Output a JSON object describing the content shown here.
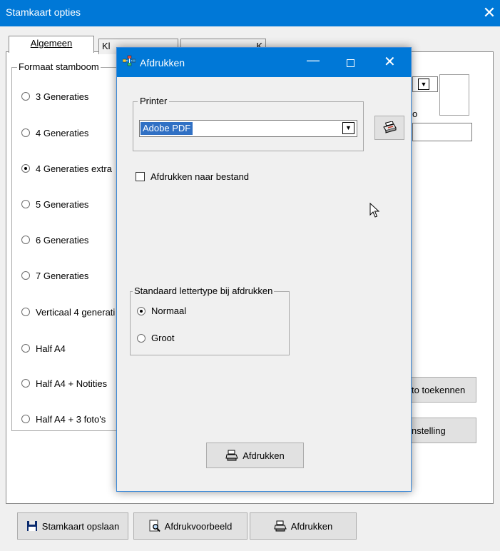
{
  "main_window": {
    "title": "Stamkaart opties",
    "close_glyph": "✕",
    "tabs": [
      "Algemeen",
      "Klein instellingen",
      "Kaart"
    ],
    "tab_visible": [
      "Algemeen",
      "Kl",
      "K"
    ],
    "format_group": {
      "label": "Formaat stamboom",
      "options": [
        {
          "label": "3 Generaties",
          "checked": false
        },
        {
          "label": "4 Generaties",
          "checked": false
        },
        {
          "label": "4 Generaties extra",
          "checked": true
        },
        {
          "label": "5 Generaties",
          "checked": false
        },
        {
          "label": "6 Generaties",
          "checked": false
        },
        {
          "label": "7 Generaties",
          "checked": false
        },
        {
          "label": "Verticaal 4 generati",
          "checked": false
        },
        {
          "label": "Half A4",
          "checked": false
        },
        {
          "label": "Half A4 + Notities",
          "checked": false
        },
        {
          "label": "Half A4 + 3 foto's",
          "checked": false
        }
      ]
    },
    "right_panel": {
      "fragment_label": "o",
      "foto_button": "to toekennen",
      "instelling_button": "nstelling"
    },
    "bottom_buttons": {
      "save": "Stamkaart opslaan",
      "preview": "Afdrukvoorbeeld",
      "print": "Afdrukken"
    }
  },
  "dialog": {
    "title": "Afdrukken",
    "minimize_glyph": "—",
    "close_glyph": "✕",
    "printer_group_label": "Printer",
    "printer_value": "Adobe PDF",
    "print_to_file_label": "Afdrukken naar bestand",
    "print_to_file_checked": false,
    "font_group_label": "Standaard lettertype bij afdrukken",
    "font_options": [
      {
        "label": "Normaal",
        "checked": true
      },
      {
        "label": "Groot",
        "checked": false
      }
    ],
    "print_button": "Afdrukken"
  },
  "icons": {
    "save": "floppy-disk-icon",
    "preview": "magnifier-document-icon",
    "print": "printer-icon",
    "dialog_app": "family-tree-icon",
    "printer_setup": "printer-setup-icon",
    "cursor": "mouse-cursor-icon"
  },
  "colors": {
    "titlebar": "#0078d7",
    "selection": "#3070c4",
    "window_bg": "#f0f0f0"
  }
}
